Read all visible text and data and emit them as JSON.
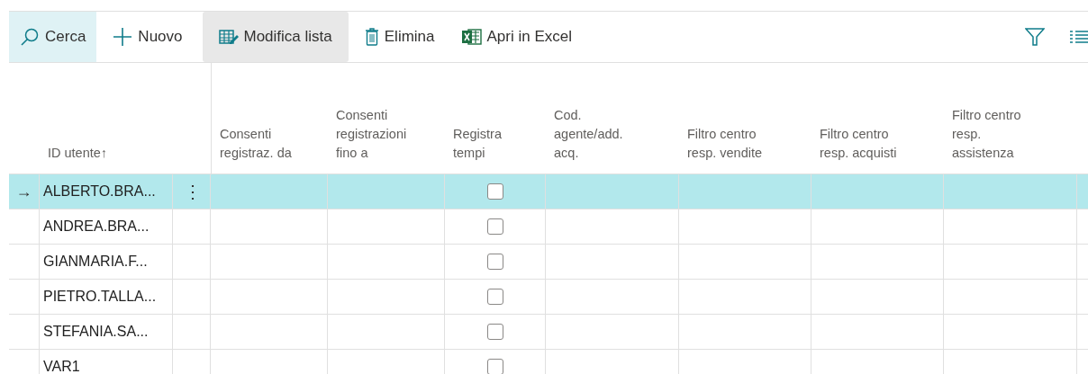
{
  "toolbar": {
    "actions": [
      {
        "kind": "search",
        "label": "Cerca",
        "hovered": false,
        "selected": true
      },
      {
        "kind": "new",
        "label": "Nuovo",
        "hovered": false,
        "selected": false
      },
      {
        "kind": "edit",
        "label": "Modifica lista",
        "hovered": true,
        "selected": false
      },
      {
        "kind": "delete",
        "label": "Elimina",
        "hovered": false,
        "selected": false
      },
      {
        "kind": "excel",
        "label": "Apri in Excel",
        "hovered": false,
        "selected": false
      }
    ]
  },
  "table": {
    "columns": [
      {
        "kind": "id",
        "lines": [
          "ID utente"
        ],
        "sort": "↑"
      },
      {
        "kind": "text",
        "lines": [
          "Consenti",
          "registraz. da"
        ]
      },
      {
        "kind": "text",
        "lines": [
          "Consenti",
          "registrazioni",
          "fino a"
        ]
      },
      {
        "kind": "check",
        "lines": [
          "Registra",
          "tempi"
        ]
      },
      {
        "kind": "text",
        "lines": [
          "Cod.",
          "agente/add.",
          "acq."
        ]
      },
      {
        "kind": "text",
        "lines": [
          "Filtro centro",
          "resp. vendite"
        ]
      },
      {
        "kind": "text",
        "lines": [
          "Filtro centro",
          "resp. acquisti"
        ]
      },
      {
        "kind": "text",
        "lines": [
          "Filtro centro",
          "resp.",
          "assistenza"
        ]
      }
    ],
    "rows": [
      {
        "marker": "→",
        "id": "ALBERTO.BRA...",
        "more": "⋮",
        "selected": true,
        "registra_tempi": false
      },
      {
        "id": "ANDREA.BRA...",
        "selected": false,
        "registra_tempi": false
      },
      {
        "id": "GIANMARIA.F...",
        "selected": false,
        "registra_tempi": false
      },
      {
        "id": "PIETRO.TALLA...",
        "selected": false,
        "registra_tempi": false
      },
      {
        "id": "STEFANIA.SA...",
        "selected": false,
        "registra_tempi": false
      },
      {
        "id": "VAR1",
        "selected": false,
        "registra_tempi": false
      }
    ]
  }
}
